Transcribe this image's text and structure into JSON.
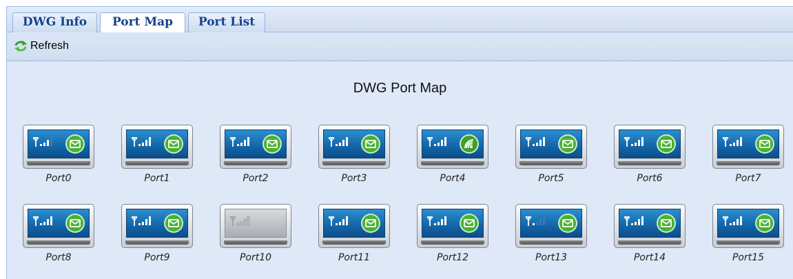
{
  "tabs": [
    {
      "label": "DWG Info",
      "active": false
    },
    {
      "label": "Port Map",
      "active": true
    },
    {
      "label": "Port List",
      "active": false
    }
  ],
  "toolbar": {
    "refresh_label": "Refresh",
    "refresh_icon": "refresh-icon"
  },
  "map": {
    "title": "DWG Port Map",
    "ports": [
      {
        "label": "Port0",
        "signal": 3,
        "state": "sms"
      },
      {
        "label": "Port1",
        "signal": 4,
        "state": "sms"
      },
      {
        "label": "Port2",
        "signal": 4,
        "state": "sms"
      },
      {
        "label": "Port3",
        "signal": 4,
        "state": "sms"
      },
      {
        "label": "Port4",
        "signal": 4,
        "state": "call"
      },
      {
        "label": "Port5",
        "signal": 4,
        "state": "sms"
      },
      {
        "label": "Port6",
        "signal": 4,
        "state": "sms"
      },
      {
        "label": "Port7",
        "signal": 4,
        "state": "sms"
      },
      {
        "label": "Port8",
        "signal": 4,
        "state": "sms"
      },
      {
        "label": "Port9",
        "signal": 4,
        "state": "sms"
      },
      {
        "label": "Port10",
        "signal": 0,
        "state": "offline"
      },
      {
        "label": "Port11",
        "signal": 4,
        "state": "sms"
      },
      {
        "label": "Port12",
        "signal": 4,
        "state": "sms"
      },
      {
        "label": "Port13",
        "signal": 1,
        "state": "sms"
      },
      {
        "label": "Port14",
        "signal": 4,
        "state": "sms"
      },
      {
        "label": "Port15",
        "signal": 4,
        "state": "sms"
      }
    ]
  },
  "colors": {
    "accent": "#15428b",
    "panel": "#1468ab",
    "status_green": "#3aa33a"
  }
}
